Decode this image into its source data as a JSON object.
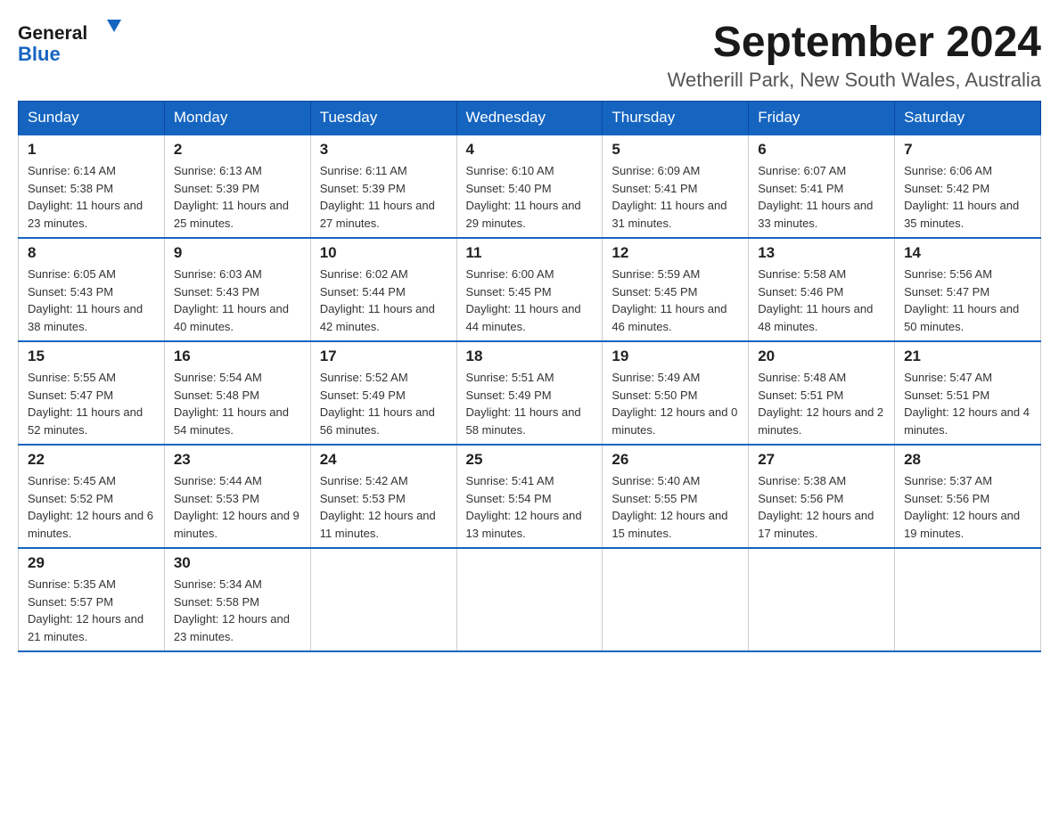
{
  "header": {
    "logo_text_general": "General",
    "logo_text_blue": "Blue",
    "month_year": "September 2024",
    "location": "Wetherill Park, New South Wales, Australia"
  },
  "days_of_week": [
    "Sunday",
    "Monday",
    "Tuesday",
    "Wednesday",
    "Thursday",
    "Friday",
    "Saturday"
  ],
  "weeks": [
    [
      {
        "day": "1",
        "sunrise": "6:14 AM",
        "sunset": "5:38 PM",
        "daylight": "11 hours and 23 minutes."
      },
      {
        "day": "2",
        "sunrise": "6:13 AM",
        "sunset": "5:39 PM",
        "daylight": "11 hours and 25 minutes."
      },
      {
        "day": "3",
        "sunrise": "6:11 AM",
        "sunset": "5:39 PM",
        "daylight": "11 hours and 27 minutes."
      },
      {
        "day": "4",
        "sunrise": "6:10 AM",
        "sunset": "5:40 PM",
        "daylight": "11 hours and 29 minutes."
      },
      {
        "day": "5",
        "sunrise": "6:09 AM",
        "sunset": "5:41 PM",
        "daylight": "11 hours and 31 minutes."
      },
      {
        "day": "6",
        "sunrise": "6:07 AM",
        "sunset": "5:41 PM",
        "daylight": "11 hours and 33 minutes."
      },
      {
        "day": "7",
        "sunrise": "6:06 AM",
        "sunset": "5:42 PM",
        "daylight": "11 hours and 35 minutes."
      }
    ],
    [
      {
        "day": "8",
        "sunrise": "6:05 AM",
        "sunset": "5:43 PM",
        "daylight": "11 hours and 38 minutes."
      },
      {
        "day": "9",
        "sunrise": "6:03 AM",
        "sunset": "5:43 PM",
        "daylight": "11 hours and 40 minutes."
      },
      {
        "day": "10",
        "sunrise": "6:02 AM",
        "sunset": "5:44 PM",
        "daylight": "11 hours and 42 minutes."
      },
      {
        "day": "11",
        "sunrise": "6:00 AM",
        "sunset": "5:45 PM",
        "daylight": "11 hours and 44 minutes."
      },
      {
        "day": "12",
        "sunrise": "5:59 AM",
        "sunset": "5:45 PM",
        "daylight": "11 hours and 46 minutes."
      },
      {
        "day": "13",
        "sunrise": "5:58 AM",
        "sunset": "5:46 PM",
        "daylight": "11 hours and 48 minutes."
      },
      {
        "day": "14",
        "sunrise": "5:56 AM",
        "sunset": "5:47 PM",
        "daylight": "11 hours and 50 minutes."
      }
    ],
    [
      {
        "day": "15",
        "sunrise": "5:55 AM",
        "sunset": "5:47 PM",
        "daylight": "11 hours and 52 minutes."
      },
      {
        "day": "16",
        "sunrise": "5:54 AM",
        "sunset": "5:48 PM",
        "daylight": "11 hours and 54 minutes."
      },
      {
        "day": "17",
        "sunrise": "5:52 AM",
        "sunset": "5:49 PM",
        "daylight": "11 hours and 56 minutes."
      },
      {
        "day": "18",
        "sunrise": "5:51 AM",
        "sunset": "5:49 PM",
        "daylight": "11 hours and 58 minutes."
      },
      {
        "day": "19",
        "sunrise": "5:49 AM",
        "sunset": "5:50 PM",
        "daylight": "12 hours and 0 minutes."
      },
      {
        "day": "20",
        "sunrise": "5:48 AM",
        "sunset": "5:51 PM",
        "daylight": "12 hours and 2 minutes."
      },
      {
        "day": "21",
        "sunrise": "5:47 AM",
        "sunset": "5:51 PM",
        "daylight": "12 hours and 4 minutes."
      }
    ],
    [
      {
        "day": "22",
        "sunrise": "5:45 AM",
        "sunset": "5:52 PM",
        "daylight": "12 hours and 6 minutes."
      },
      {
        "day": "23",
        "sunrise": "5:44 AM",
        "sunset": "5:53 PM",
        "daylight": "12 hours and 9 minutes."
      },
      {
        "day": "24",
        "sunrise": "5:42 AM",
        "sunset": "5:53 PM",
        "daylight": "12 hours and 11 minutes."
      },
      {
        "day": "25",
        "sunrise": "5:41 AM",
        "sunset": "5:54 PM",
        "daylight": "12 hours and 13 minutes."
      },
      {
        "day": "26",
        "sunrise": "5:40 AM",
        "sunset": "5:55 PM",
        "daylight": "12 hours and 15 minutes."
      },
      {
        "day": "27",
        "sunrise": "5:38 AM",
        "sunset": "5:56 PM",
        "daylight": "12 hours and 17 minutes."
      },
      {
        "day": "28",
        "sunrise": "5:37 AM",
        "sunset": "5:56 PM",
        "daylight": "12 hours and 19 minutes."
      }
    ],
    [
      {
        "day": "29",
        "sunrise": "5:35 AM",
        "sunset": "5:57 PM",
        "daylight": "12 hours and 21 minutes."
      },
      {
        "day": "30",
        "sunrise": "5:34 AM",
        "sunset": "5:58 PM",
        "daylight": "12 hours and 23 minutes."
      },
      null,
      null,
      null,
      null,
      null
    ]
  ],
  "labels": {
    "sunrise_prefix": "Sunrise: ",
    "sunset_prefix": "Sunset: ",
    "daylight_prefix": "Daylight: "
  }
}
